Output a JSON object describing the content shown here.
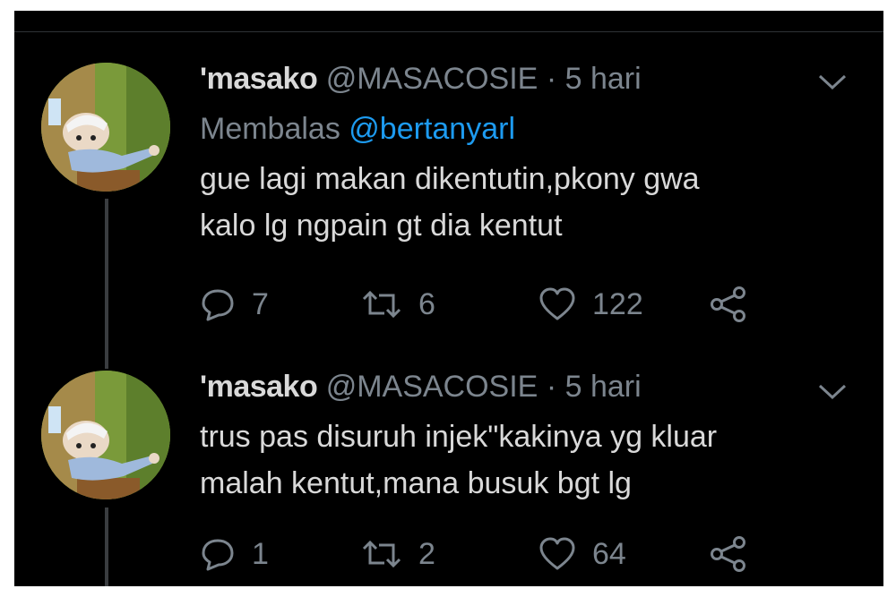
{
  "tweets": [
    {
      "display_name": "'masako",
      "handle": "@MASACOSIE",
      "separator": "·",
      "time": "5 hari",
      "reply_prefix": "Membalas",
      "reply_to": "@bertanyarl",
      "text_lines": [
        "gue lagi makan dikentutin,pkony gwa",
        "kalo lg ngpain gt dia kentut"
      ],
      "replies": "7",
      "retweets": "6",
      "likes": "122",
      "avatar_icon": "cartoon-character-avatar"
    },
    {
      "display_name": "'masako",
      "handle": "@MASACOSIE",
      "separator": "·",
      "time": "5 hari",
      "text_lines": [
        "trus pas disuruh injek\"kakinya yg kluar",
        "malah kentut,mana busuk bgt lg"
      ],
      "replies": "1",
      "retweets": "2",
      "likes": "64",
      "avatar_icon": "cartoon-character-avatar"
    }
  ],
  "icons": {
    "reply": "speech-bubble-icon",
    "retweet": "retweet-arrows-icon",
    "like": "heart-icon",
    "share": "share-nodes-icon",
    "menu": "chevron-down-icon"
  },
  "colors": {
    "background": "#000000",
    "text": "#d9d9d9",
    "muted": "#7c858e",
    "link": "#1d9bf0"
  }
}
